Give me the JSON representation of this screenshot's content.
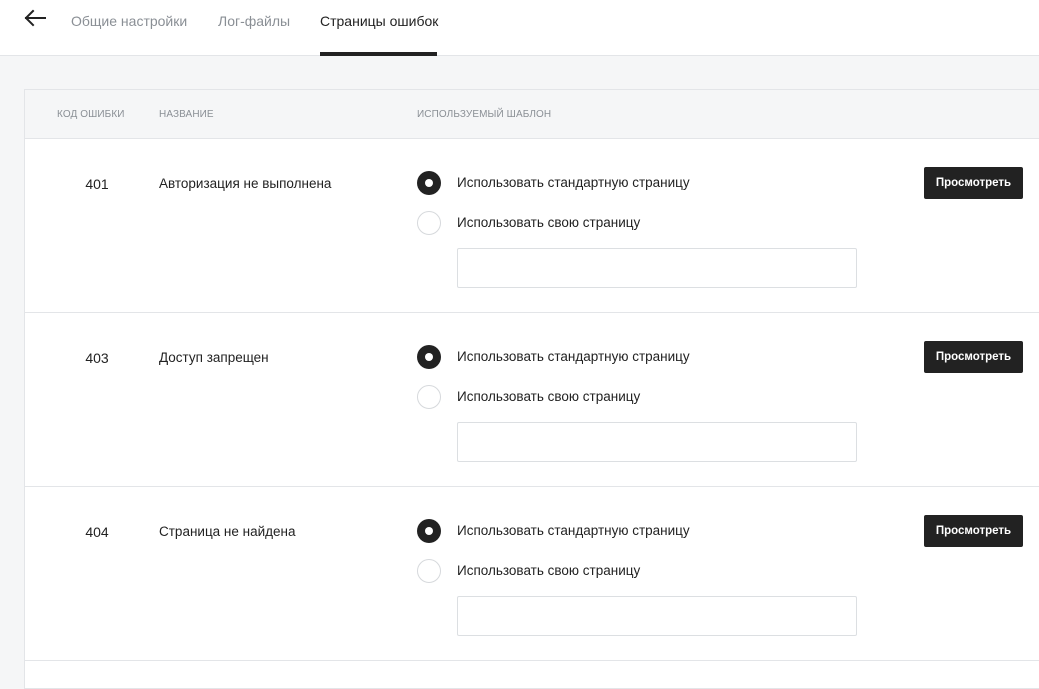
{
  "tabs": [
    {
      "label": "Общие настройки",
      "active": false
    },
    {
      "label": "Лог-файлы",
      "active": false
    },
    {
      "label": "Страницы ошибок",
      "active": true
    }
  ],
  "table": {
    "headers": {
      "code": "КОД ОШИБКИ",
      "name": "НАЗВАНИЕ",
      "template": "ИСПОЛЬЗУЕМЫЙ ШАБЛОН"
    },
    "rows": [
      {
        "code": "401",
        "name": "Авторизация не выполнена",
        "option_default": "Использовать стандартную страницу",
        "option_custom": "Использовать свою страницу",
        "selected": "default",
        "custom_value": "",
        "button": "Просмотреть"
      },
      {
        "code": "403",
        "name": "Доступ запрещен",
        "option_default": "Использовать стандартную страницу",
        "option_custom": "Использовать свою страницу",
        "selected": "default",
        "custom_value": "",
        "button": "Просмотреть"
      },
      {
        "code": "404",
        "name": "Страница не найдена",
        "option_default": "Использовать стандартную страницу",
        "option_custom": "Использовать свою страницу",
        "selected": "default",
        "custom_value": "",
        "button": "Просмотреть"
      }
    ]
  },
  "icons": {
    "back": "arrow-left-icon"
  },
  "colors": {
    "primary": "#222222",
    "muted": "#8a8f95",
    "border": "#e3e5e8",
    "background": "#f5f6f7"
  }
}
